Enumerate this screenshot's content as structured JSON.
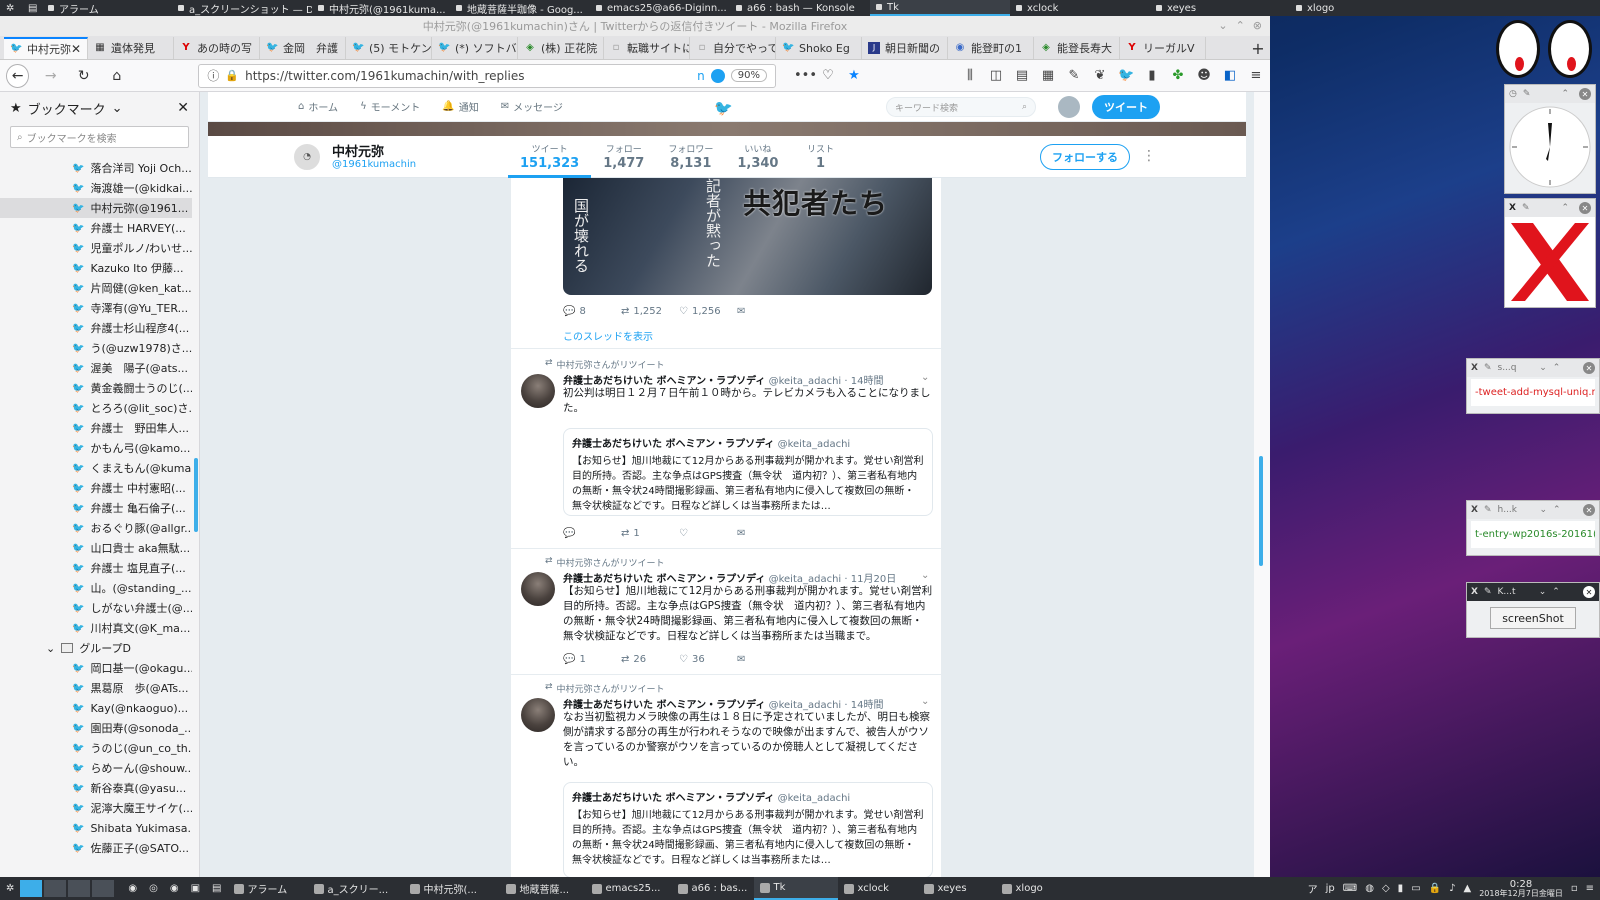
{
  "desktop_topbar": {
    "items": [
      {
        "label": "アラーム"
      },
      {
        "label": "a_スクリーンショット — D..."
      },
      {
        "label": "中村元弥(@1961kuma..."
      },
      {
        "label": "地蔵菩薩半跏像 - Goog..."
      },
      {
        "label": "emacs25@a66-Diginn..."
      },
      {
        "label": "a66 : bash — Konsole"
      },
      {
        "label": "Tk"
      },
      {
        "label": "xclock"
      },
      {
        "label": "xeyes"
      },
      {
        "label": "xlogo"
      }
    ]
  },
  "window": {
    "title": "中村元弥(@1961kumachin)さん | Twitterからの返信付きツイート - Mozilla Firefox"
  },
  "browser_tabs": [
    {
      "label": "中村元弥",
      "icon": "twitter-icon",
      "active": true
    },
    {
      "label": "遺体発見",
      "icon": "page-icon"
    },
    {
      "label": "あの時の写",
      "icon": "yahoo-icon"
    },
    {
      "label": "金岡　弁護",
      "icon": "twitter-icon"
    },
    {
      "label": "(5) モトケン",
      "icon": "twitter-icon"
    },
    {
      "label": "(*) ソフトバ",
      "icon": "twitter-icon"
    },
    {
      "label": "(株) 正花院",
      "icon": "maps-icon"
    },
    {
      "label": "転職サイトにお",
      "icon": "page-icon"
    },
    {
      "label": "自分でやってみ",
      "icon": "page-icon"
    },
    {
      "label": "Shoko Eg",
      "icon": "twitter-icon"
    },
    {
      "label": "朝日新聞の",
      "icon": "news-icon"
    },
    {
      "label": "能登町の1",
      "icon": "page-icon"
    },
    {
      "label": "能登長寿大",
      "icon": "maps-icon"
    },
    {
      "label": "リーガルV",
      "icon": "yahoo-icon"
    }
  ],
  "navbar": {
    "url": "https://twitter.com/1961kumachin/with_replies",
    "zoom": "90%",
    "n_label": "n"
  },
  "sidebar": {
    "title": "ブックマーク",
    "search_placeholder": "ブックマークを検索",
    "items": [
      {
        "label": "落合洋司 Yoji Och..."
      },
      {
        "label": "海渡雄一(@kidkai..."
      },
      {
        "label": "中村元弥(@1961...",
        "selected": true
      },
      {
        "label": "弁護士 HARVEY(..."
      },
      {
        "label": "児童ポルノ/わいせ..."
      },
      {
        "label": "Kazuko Ito 伊藤..."
      },
      {
        "label": "片岡健(@ken_kat..."
      },
      {
        "label": "寺澤有(@Yu_TER..."
      },
      {
        "label": "弁護士杉山程彦4(..."
      },
      {
        "label": "う(@uzw1978)さ..."
      },
      {
        "label": "渥美　陽子(@ats..."
      },
      {
        "label": "黄金義闘士うのじ(..."
      },
      {
        "label": "とろろ(@lit_soc)さ..."
      },
      {
        "label": "弁護士　野田隼人..."
      },
      {
        "label": "かもん弓(@kamo..."
      },
      {
        "label": "くまえもん(@kuma..."
      },
      {
        "label": "弁護士 中村憲昭(..."
      },
      {
        "label": "弁護士 亀石倫子(..."
      },
      {
        "label": "おるぐり豚(@allgr..."
      },
      {
        "label": "山口貴士 aka無駄..."
      },
      {
        "label": "弁護士 塩見直子(..."
      },
      {
        "label": "山。(@standing_..."
      },
      {
        "label": "しがない弁護士(@..."
      },
      {
        "label": "川村真文(@K_ma..."
      }
    ],
    "folder": "グループD",
    "folder_items": [
      {
        "label": "岡口基一(@okagu..."
      },
      {
        "label": "黒葛原　歩(@ATs..."
      },
      {
        "label": "Kay(@nkaoguo)..."
      },
      {
        "label": "園田寿(@sonoda_..."
      },
      {
        "label": "うのじ(@un_co_th..."
      },
      {
        "label": "らめーん(@shouw..."
      },
      {
        "label": "新谷泰真(@yasu..."
      },
      {
        "label": "泥濘大魔王サイケ(..."
      },
      {
        "label": "Shibata Yukimasa..."
      },
      {
        "label": "佐藤正子(@SATO..."
      }
    ]
  },
  "twitter_nav": {
    "home": "ホーム",
    "moments": "モーメント",
    "notifications": "通知",
    "messages": "メッセージ",
    "search_placeholder": "キーワード検索",
    "tweet_button": "ツイート"
  },
  "profile": {
    "name": "中村元弥",
    "handle": "@1961kumachin",
    "stats": [
      {
        "label": "ツイート",
        "value": "151,323",
        "active": true
      },
      {
        "label": "フォロー",
        "value": "1,477"
      },
      {
        "label": "フォロワー",
        "value": "8,131"
      },
      {
        "label": "いいね",
        "value": "1,340"
      },
      {
        "label": "リスト",
        "value": "1"
      }
    ],
    "follow_button": "フォローする"
  },
  "tweets": [
    {
      "image_title": "共犯者たち",
      "image_text_1": "国が壊れる",
      "image_text_2": "記者が黙った",
      "replies": "8",
      "retweets": "1,252",
      "likes": "1,256",
      "show_thread": "このスレッドを表示"
    },
    {
      "retweeted_by": "中村元弥さんがリツイート",
      "author": "弁護士あだちけいた ボヘミアン・ラプソディ",
      "handle": "@keita_adachi",
      "time": "· 14時間",
      "text": "初公判は明日１２月７日午前１０時から。テレビカメラも入ることになりました。",
      "quote_author": "弁護士あだちけいた ボヘミアン・ラプソディ",
      "quote_handle": "@keita_adachi",
      "quote_text": "【お知らせ】旭川地裁にて12月からある刑事裁判が開かれます。覚せい剤営利目的所持。否認。主な争点はGPS捜査（無令状　道内初？）、第三者私有地内の無断・無令状24時間撮影録画、第三者私有地内に侵入して複数回の無断・無令状検証などです。日程など詳しくは当事務所または…",
      "replies": "",
      "retweets": "1",
      "likes": ""
    },
    {
      "retweeted_by": "中村元弥さんがリツイート",
      "author": "弁護士あだちけいた ボヘミアン・ラプソディ",
      "handle": "@keita_adachi",
      "time": "· 11月20日",
      "text": "【お知らせ】旭川地裁にて12月からある刑事裁判が開かれます。覚せい剤営利目的所持。否認。主な争点はGPS捜査（無令状　道内初？）、第三者私有地内の無断・無令状24時間撮影録画、第三者私有地内に侵入して複数回の無断・無令状検証などです。日程など詳しくは当事務所または当職まで。",
      "replies": "1",
      "retweets": "26",
      "likes": "36"
    },
    {
      "retweeted_by": "中村元弥さんがリツイート",
      "author": "弁護士あだちけいた ボヘミアン・ラプソディ",
      "handle": "@keita_adachi",
      "time": "· 14時間",
      "text": "なお当初監視カメラ映像の再生は１８日に予定されていましたが、明日も検察側が請求する部分の再生が行われそうなので映像が出ますんで、被告人がウソを言っているのか警察がウソを言っているのか傍聴人として凝視してください。",
      "quote_author": "弁護士あだちけいた ボヘミアン・ラプソディ",
      "quote_handle": "@keita_adachi",
      "quote_text": "【お知らせ】旭川地裁にて12月からある刑事裁判が開かれます。覚せい剤営利目的所持。否認。主な争点はGPS捜査（無令状　道内初？）、第三者私有地内の無断・無令状24時間撮影録画、第三者私有地内に侵入して複数回の無断・無令状検証などです。日程など詳しくは当事務所または…"
    }
  ],
  "right_panels": {
    "p1_title": "s...q",
    "p1_text": "-tweet-add-mysql-uniq.rb",
    "p2_title": "h...k",
    "p2_text": "t-entry-wp2016s-20161(",
    "p3_title": "K...t",
    "p3_button": "screenShot"
  },
  "taskbar": {
    "items": [
      {
        "label": "アラーム"
      },
      {
        "label": "a_スクリー..."
      },
      {
        "label": "中村元弥(..."
      },
      {
        "label": "地蔵菩薩..."
      },
      {
        "label": "emacs25..."
      },
      {
        "label": "a66 : bas..."
      },
      {
        "label": "Tk"
      },
      {
        "label": "xclock"
      },
      {
        "label": "xeyes"
      },
      {
        "label": "xlogo"
      }
    ],
    "lang": "jp",
    "time": "0:28",
    "date": "2018年12月7日金曜日"
  },
  "colors": {
    "accent": "#1da1f2",
    "kde_accent": "#3daee9",
    "xlogo_red": "#e0141c"
  }
}
